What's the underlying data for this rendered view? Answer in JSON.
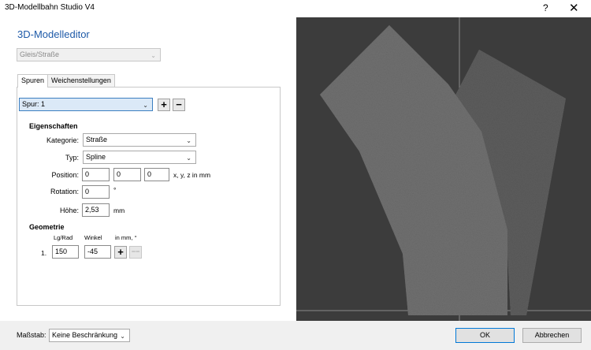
{
  "window": {
    "title": "3D-Modellbahn Studio V4",
    "help": "?",
    "close": "✕"
  },
  "editor": {
    "heading": "3D-Modelleditor",
    "type_combo": "Gleis/Straße",
    "tabs": [
      "Spuren",
      "Weichenstellungen"
    ],
    "spur_combo": "Spur: 1",
    "add": "+",
    "remove": "−",
    "properties": {
      "title": "Eigenschaften",
      "kategorie_label": "Kategorie:",
      "kategorie_value": "Straße",
      "typ_label": "Typ:",
      "typ_value": "Spline",
      "position_label": "Position:",
      "position_x": "0",
      "position_y": "0",
      "position_z": "0",
      "position_unit": "x, y, z in mm",
      "rotation_label": "Rotation:",
      "rotation_value": "0",
      "rotation_unit": "°",
      "hoehe_label": "Höhe:",
      "hoehe_value": "2,53",
      "hoehe_unit": "mm"
    },
    "geometry": {
      "title": "Geometrie",
      "col_lg": "Lg/Rad",
      "col_winkel": "Winkel",
      "col_unit": "in mm, °",
      "row_index": "1.",
      "row_lg": "150",
      "row_winkel": "-45",
      "add": "+",
      "remove": "−−"
    }
  },
  "footer": {
    "scale_label": "Maßstab:",
    "scale_value": "Keine Beschränkung",
    "ok": "OK",
    "cancel": "Abbrechen"
  },
  "icons": {
    "dropdown": "chevron-down-icon",
    "close": "close-icon",
    "help": "help-icon"
  },
  "colors": {
    "heading": "#1e5aa8",
    "preview_bg": "#3c3c3c",
    "road": "#6e6e6e",
    "selection": "#dbe9f7",
    "default_button_border": "#0078d7"
  }
}
